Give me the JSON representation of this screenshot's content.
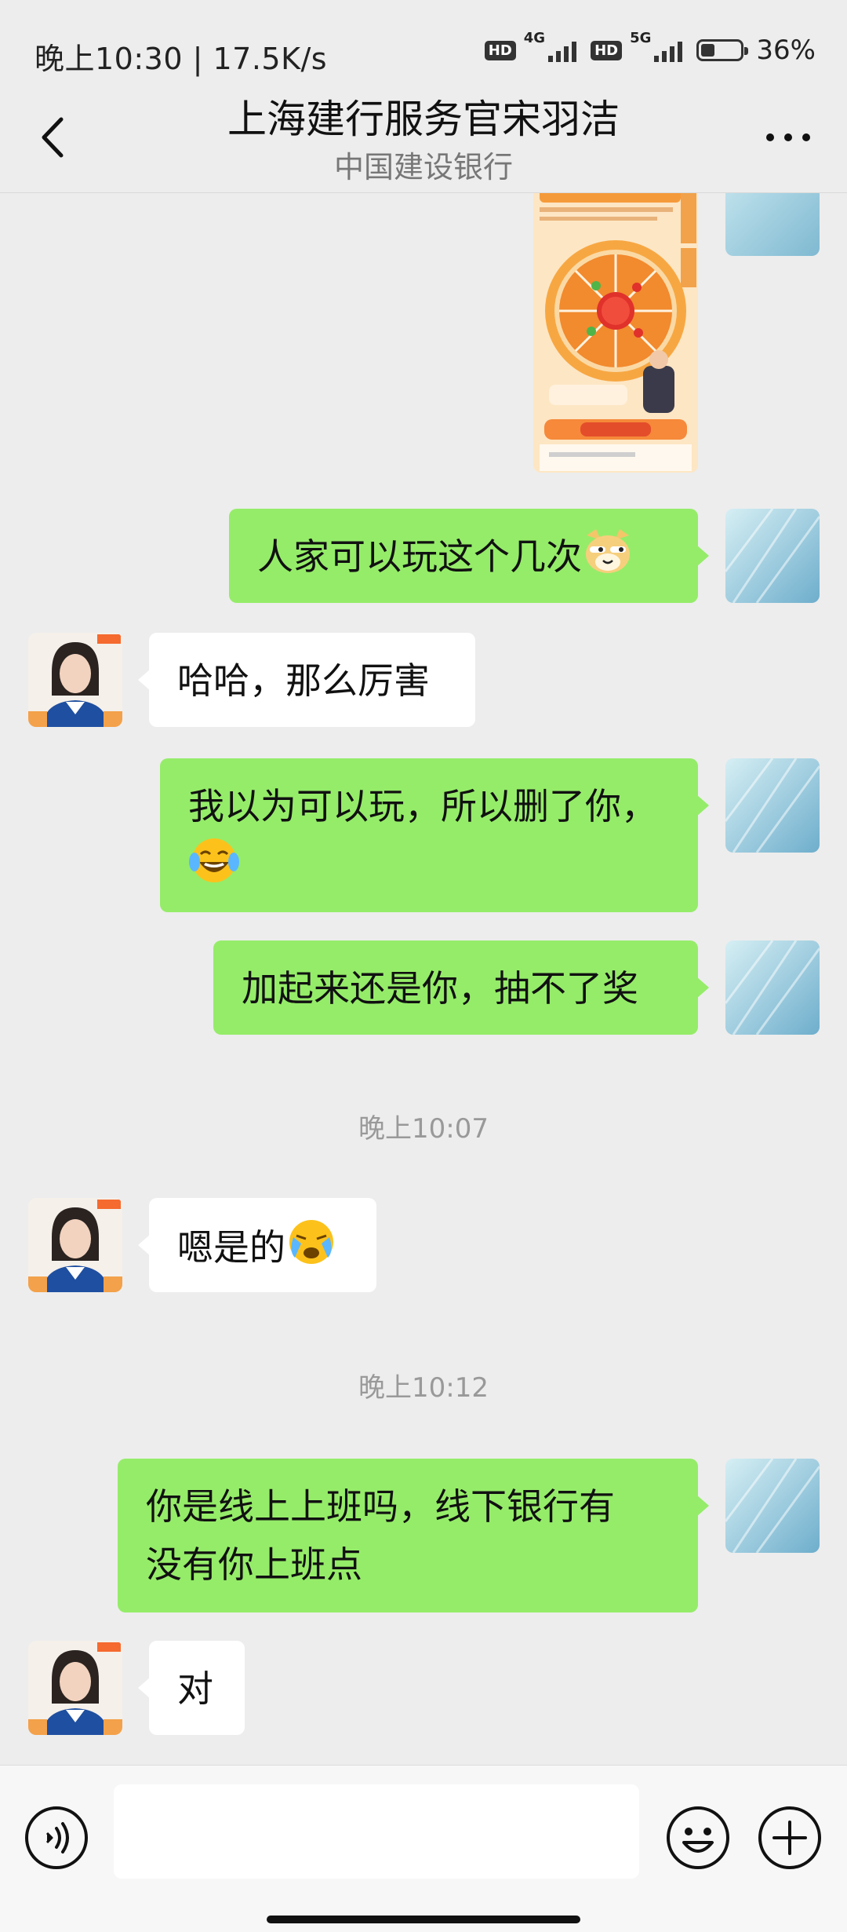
{
  "status_bar": {
    "time_speed": "晚上10:30 | 17.5K/s",
    "hd_badge_1": "HD",
    "network_1": "4G",
    "hd_badge_2": "HD",
    "network_2": "5G",
    "battery_percent": "36%",
    "battery_level": 0.36
  },
  "header": {
    "title": "上海建行服务官宋羽洁",
    "subtitle": "中国建设银行",
    "back_icon": "chevron-left-icon",
    "more_icon": "more-horizontal-icon"
  },
  "messages": [
    {
      "sender": "me",
      "type": "image"
    },
    {
      "sender": "me",
      "type": "text",
      "text": "人家可以玩这个几次",
      "emoji": "doge-emoji"
    },
    {
      "sender": "them",
      "type": "text",
      "text": "哈哈，那么厉害"
    },
    {
      "sender": "me",
      "type": "text",
      "line1": "我以为可以玩，所以删了你，",
      "emoji": "tears-of-joy-emoji"
    },
    {
      "sender": "me",
      "type": "text",
      "text": "加起来还是你，抽不了奖"
    },
    {
      "type": "timestamp",
      "text": "晚上10:07"
    },
    {
      "sender": "them",
      "type": "text",
      "text": "嗯是的",
      "emoji": "crying-face-emoji"
    },
    {
      "type": "timestamp",
      "text": "晚上10:12"
    },
    {
      "sender": "me",
      "type": "text",
      "line1": "你是线上上班吗，线下银行有",
      "line2": "没有你上班点"
    },
    {
      "sender": "them",
      "type": "text",
      "text": "对"
    }
  ],
  "input_bar": {
    "placeholder": "",
    "voice_icon": "voice-icon",
    "emoji_icon": "smiley-icon",
    "plus_icon": "plus-circle-icon"
  },
  "colors": {
    "background": "#ededed",
    "my_bubble": "#95ec69",
    "their_bubble": "#ffffff"
  }
}
